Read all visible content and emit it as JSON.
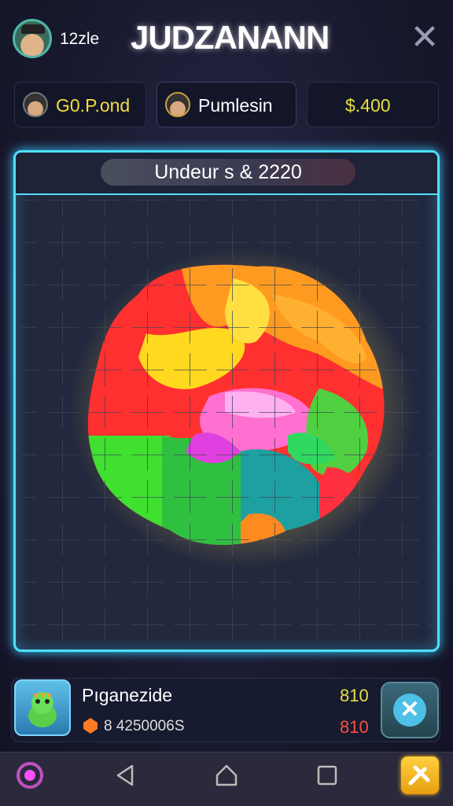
{
  "header": {
    "player_name": "12zle",
    "app_title": "JUDZANANN",
    "close_icon": "close-icon"
  },
  "chips": [
    {
      "label": "G0.P.ond",
      "color": "#f5dc40"
    },
    {
      "label": "Pumlesin",
      "color": "#ffffff"
    },
    {
      "label": "$.400",
      "color": "#e8e040"
    }
  ],
  "board": {
    "title": "Undeur s & 2220",
    "accent": "#4ee0ff"
  },
  "item": {
    "name": "Pıganezide",
    "desc": "8 4250006S",
    "stat_top": "810",
    "stat_bottom": "810",
    "stat_top_color": "#e8e040",
    "stat_bottom_color": "#ff5040"
  },
  "nav": {
    "icons": [
      "settings-icon",
      "back-icon",
      "home-icon",
      "recent-apps-icon",
      "tools-icon"
    ]
  }
}
